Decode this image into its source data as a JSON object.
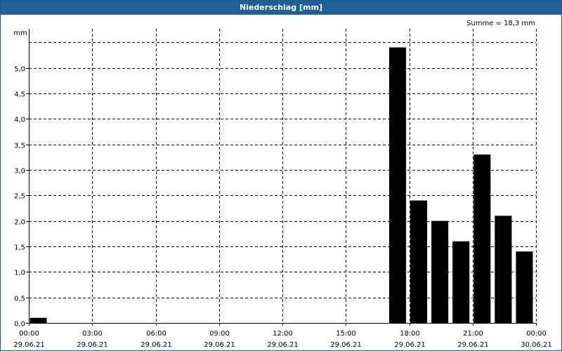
{
  "window": {
    "title": "Niederschlag [mm]"
  },
  "chart_data": {
    "type": "bar",
    "title": "Niederschlag [mm]",
    "summary": "Summe = 18,3 mm",
    "ylabel": "mm",
    "xlabel": "",
    "ylim": [
      0,
      5.5
    ],
    "y_ticks": [
      {
        "value": 0,
        "label": "0,0"
      },
      {
        "value": 0.5,
        "label": "0,5"
      },
      {
        "value": 1.0,
        "label": "1,0"
      },
      {
        "value": 1.5,
        "label": "1,5"
      },
      {
        "value": 2.0,
        "label": "2,0"
      },
      {
        "value": 2.5,
        "label": "2,5"
      },
      {
        "value": 3.0,
        "label": "3,0"
      },
      {
        "value": 3.5,
        "label": "3,5"
      },
      {
        "value": 4.0,
        "label": "4,0"
      },
      {
        "value": 4.5,
        "label": "4,5"
      },
      {
        "value": 5.0,
        "label": "5,0"
      }
    ],
    "x_range_hours": [
      0,
      24
    ],
    "x_ticks": [
      {
        "hour": 0,
        "time": "00:00",
        "date": "29.06.21"
      },
      {
        "hour": 3,
        "time": "03:00",
        "date": "29.06.21"
      },
      {
        "hour": 6,
        "time": "06:00",
        "date": "29.06.21"
      },
      {
        "hour": 9,
        "time": "09:00",
        "date": "29.06.21"
      },
      {
        "hour": 12,
        "time": "12:00",
        "date": "29.06.21"
      },
      {
        "hour": 15,
        "time": "15:00",
        "date": "29.06.21"
      },
      {
        "hour": 18,
        "time": "18:00",
        "date": "29.06.21"
      },
      {
        "hour": 21,
        "time": "21:00",
        "date": "29.06.21"
      },
      {
        "hour": 24,
        "time": "00:00",
        "date": "30.06.21"
      }
    ],
    "bar_width_hours": 0.8,
    "bars": [
      {
        "start": "29.06.21 00:00",
        "value": 0.1
      },
      {
        "start": "29.06.21 17:00",
        "value": 5.4
      },
      {
        "start": "29.06.21 18:00",
        "value": 2.4
      },
      {
        "start": "29.06.21 19:00",
        "value": 2.0
      },
      {
        "start": "29.06.21 20:00",
        "value": 1.6
      },
      {
        "start": "29.06.21 21:00",
        "value": 3.3
      },
      {
        "start": "29.06.21 22:00",
        "value": 2.1
      },
      {
        "start": "29.06.21 23:00",
        "value": 1.4
      }
    ],
    "grid": true,
    "colors": {
      "bar": "#000000",
      "grid": "#000000",
      "title_bar": "#1f6096"
    }
  }
}
